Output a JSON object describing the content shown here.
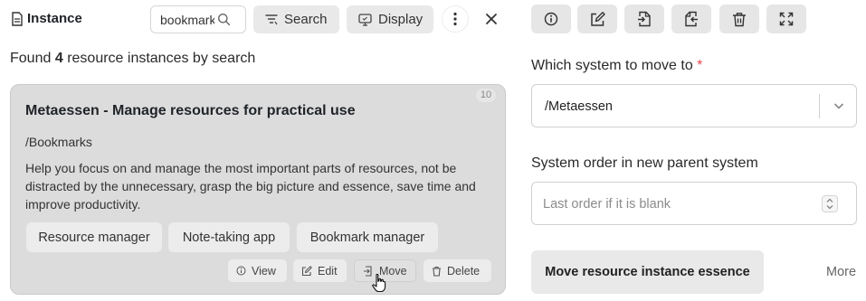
{
  "header": {
    "title": "Instance",
    "search_value": "bookmarks",
    "search_button": "Search",
    "display_button": "Display"
  },
  "results": {
    "prefix": "Found",
    "count": "4",
    "suffix": "resource instances by search"
  },
  "card": {
    "badge": "10",
    "title": "Metaessen - Manage resources for practical use",
    "path": "/Bookmarks",
    "description": "Help you focus on and manage the most important parts of resources, not be distracted by the unnecessary, grasp the big picture and essence, save time and improve productivity.",
    "tags": [
      "Resource manager",
      "Note-taking app",
      "Bookmark manager"
    ],
    "actions": {
      "view": "View",
      "edit": "Edit",
      "move": "Move",
      "delete": "Delete"
    }
  },
  "form": {
    "system_label": "Which system to move to",
    "required_mark": "*",
    "system_value": "/Metaessen",
    "order_label": "System order in new parent system",
    "order_placeholder": "Last order if it is blank",
    "submit": "Move resource instance essence",
    "more": "More"
  },
  "icons": {
    "title": "document-icon",
    "search": "search-icon",
    "filter": "filter-icon",
    "display": "display-icon",
    "menu": "more-vertical-icon",
    "close": "close-icon",
    "toolbar": [
      "info-icon",
      "edit-icon",
      "import-icon",
      "export-icon",
      "trash-icon",
      "fullscreen-icon"
    ]
  },
  "colors": {
    "card_bg": "#dcdcdc",
    "button_bg": "#e9e9e9",
    "required": "#e5484d"
  }
}
